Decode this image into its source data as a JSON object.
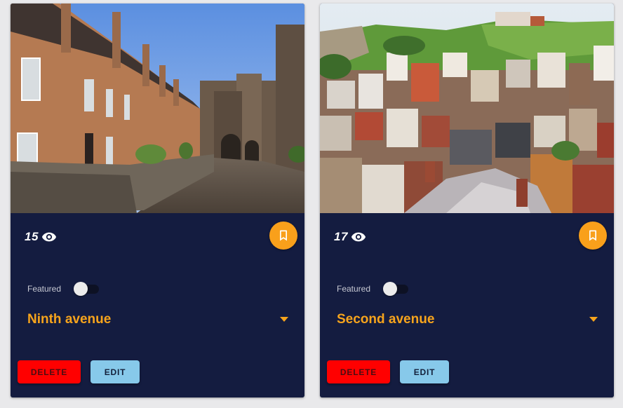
{
  "colors": {
    "card_bg": "#141c40",
    "accent": "#f7a41c",
    "delete": "#ff0000",
    "edit": "#87c9ea"
  },
  "icons": {
    "views": "eye-icon",
    "bookmark": "bookmark-icon",
    "expand": "caret-down-icon"
  },
  "cards": [
    {
      "views": "15",
      "featured_label": "Featured",
      "featured_on": false,
      "title": "Ninth avenue",
      "delete_label": "DELETE",
      "edit_label": "EDIT"
    },
    {
      "views": "17",
      "featured_label": "Featured",
      "featured_on": false,
      "title": "Second avenue",
      "delete_label": "DELETE",
      "edit_label": "EDIT"
    }
  ]
}
